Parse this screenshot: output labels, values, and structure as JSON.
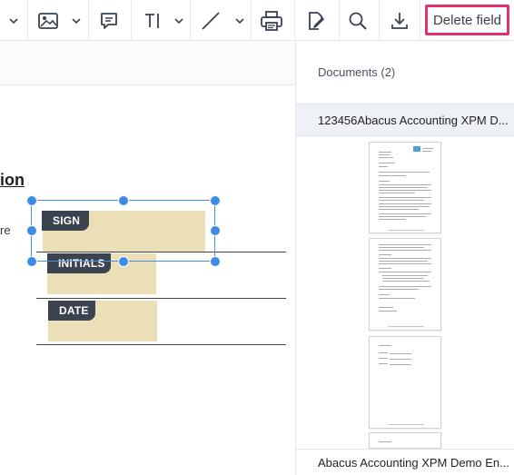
{
  "toolbar": {
    "icons": [
      "image-icon",
      "comment-icon",
      "text-icon",
      "line-icon",
      "print-icon",
      "sign-edit-icon",
      "search-icon",
      "download-icon"
    ],
    "delete_field_label": "Delete field"
  },
  "document": {
    "heading_fragment": "ion",
    "label_fragment": "re",
    "fields": [
      {
        "tag": "SIGN"
      },
      {
        "tag": "INITIALS"
      },
      {
        "tag": "DATE"
      }
    ]
  },
  "panel": {
    "documents_title": "Documents (2)",
    "documents": [
      {
        "name": "123456Abacus Accounting XPM D..."
      },
      {
        "name": "Abacus Accounting XPM Demo En..."
      }
    ]
  },
  "colors": {
    "selection": "#4a90e2",
    "field_fill": "#ebdfb8",
    "tag_bg": "#3c4350",
    "delete_border": "#e0336e"
  }
}
